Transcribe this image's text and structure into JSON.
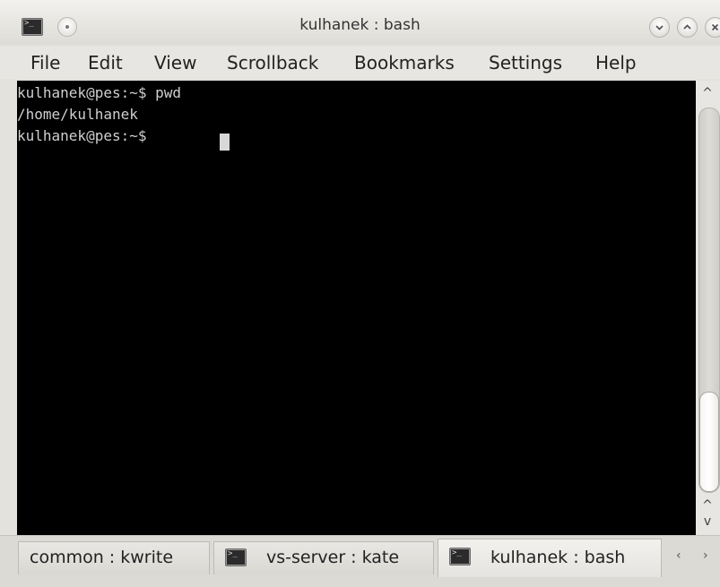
{
  "window": {
    "title": "kulhanek : bash",
    "app_icon_glyph": ">_"
  },
  "menubar": {
    "items": [
      "File",
      "Edit",
      "View",
      "Scrollback",
      "Bookmarks",
      "Settings",
      "Help"
    ]
  },
  "terminal": {
    "lines": [
      "kulhanek@pes:~$ pwd",
      "/home/kulhanek",
      "kulhanek@pes:~$ "
    ],
    "background": "#000000",
    "foreground": "#cfcfcf"
  },
  "tabs": [
    {
      "label": "common : kwrite",
      "icon": null,
      "active": false
    },
    {
      "label": "vs-server : kate",
      "icon": "terminal-icon",
      "active": false
    },
    {
      "label": "kulhanek : bash",
      "icon": "terminal-icon",
      "active": true
    }
  ],
  "tab_scroll": {
    "left": "‹",
    "right": "›"
  },
  "scrollbar": {
    "up": "^",
    "down_upper": "^",
    "down_lower": "v"
  }
}
